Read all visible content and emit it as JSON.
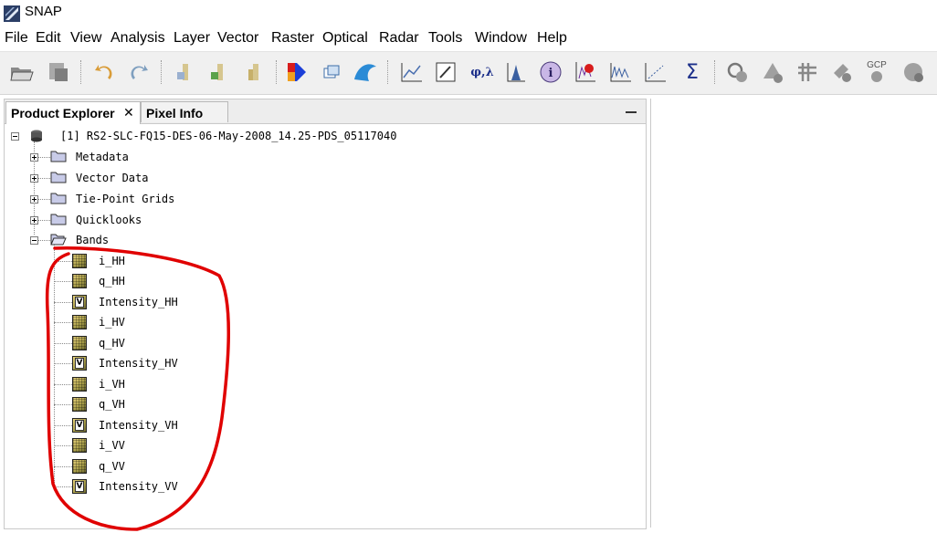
{
  "app": {
    "title": "SNAP"
  },
  "menu": [
    "File",
    "Edit",
    "View",
    "Analysis",
    "Layer",
    "Vector",
    "Raster",
    "Optical",
    "Radar",
    "Tools",
    "Window",
    "Help"
  ],
  "toolbar": {
    "icons": [
      "open-product-icon",
      "save-product-icon",
      "undo-icon",
      "redo-icon",
      "import-icon",
      "export-icon",
      "export-band-icon",
      "color-manipulation-icon",
      "layer-manager-icon",
      "wave-icon",
      "spectrum-icon",
      "pin-icon",
      "geo-location-icon",
      "histogram-icon",
      "information-icon",
      "statistics-icon",
      "profile-plot-icon",
      "scatter-plot-icon",
      "sum-icon",
      "mask-icon",
      "graph-icon",
      "grid-icon",
      "range-finder-icon",
      "gcp-icon",
      "time-series-icon"
    ],
    "phi_lambda": "φ,λ",
    "sigma": "Σ",
    "gcp": "GCP"
  },
  "panel": {
    "tabs": [
      {
        "label": "Product Explorer",
        "active": true
      },
      {
        "label": "Pixel Info",
        "active": false
      }
    ],
    "close_glyph": "✕"
  },
  "tree": {
    "product": "[1] RS2-SLC-FQ15-DES-06-May-2008_14.25-PDS_05117040",
    "folders": [
      "Metadata",
      "Vector Data",
      "Tie-Point Grids",
      "Quicklooks",
      "Bands"
    ],
    "bands": [
      {
        "name": "i_HH",
        "virtual": false
      },
      {
        "name": "q_HH",
        "virtual": false
      },
      {
        "name": "Intensity_HH",
        "virtual": true
      },
      {
        "name": "i_HV",
        "virtual": false
      },
      {
        "name": "q_HV",
        "virtual": false
      },
      {
        "name": "Intensity_HV",
        "virtual": true
      },
      {
        "name": "i_VH",
        "virtual": false
      },
      {
        "name": "q_VH",
        "virtual": false
      },
      {
        "name": "Intensity_VH",
        "virtual": true
      },
      {
        "name": "i_VV",
        "virtual": false
      },
      {
        "name": "q_VV",
        "virtual": false
      },
      {
        "name": "Intensity_VV",
        "virtual": true
      }
    ],
    "virtual_band_glyph": "V"
  },
  "colors": {
    "annotation": "#e00000",
    "folder": "#c8cbe8",
    "tab_border": "#b9b9b9"
  }
}
